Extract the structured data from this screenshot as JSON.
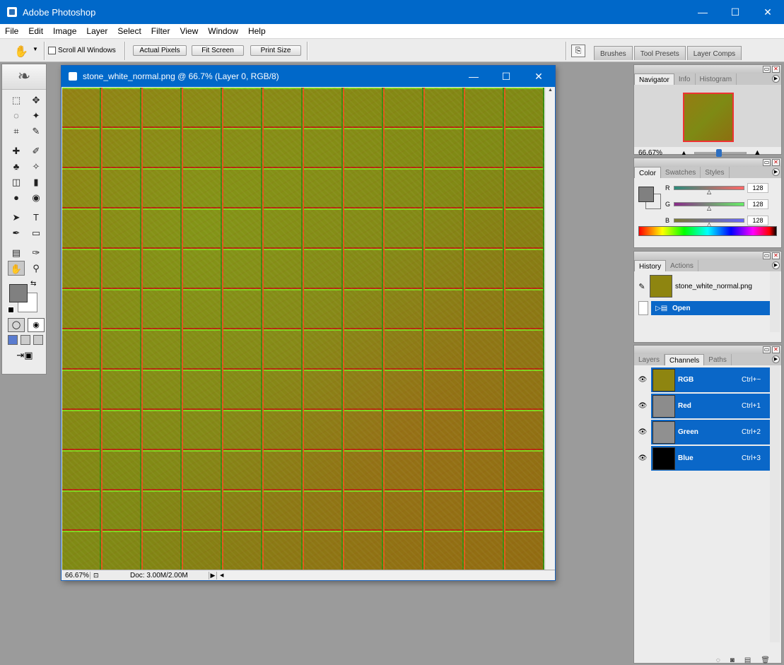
{
  "app": {
    "title": "Adobe Photoshop",
    "window_buttons": [
      "—",
      "☐",
      "✕"
    ]
  },
  "menu": [
    "File",
    "Edit",
    "Image",
    "Layer",
    "Select",
    "Filter",
    "View",
    "Window",
    "Help"
  ],
  "options": {
    "tool_icon": "hand-icon",
    "scroll_all_windows": "Scroll All Windows",
    "actual_pixels": "Actual Pixels",
    "fit_screen": "Fit Screen",
    "print_size": "Print Size",
    "well_tabs": [
      "Brushes",
      "Tool Presets",
      "Layer Comps"
    ]
  },
  "tools": [
    [
      "⬚",
      "✥"
    ],
    [
      "◌",
      "✦"
    ],
    [
      "⌗",
      "✎"
    ],
    [
      "✚",
      "✐"
    ],
    [
      "♣",
      "✧"
    ],
    [
      "◫",
      "▮"
    ],
    [
      "●",
      "◉"
    ],
    [
      "➤",
      "T"
    ],
    [
      "✒",
      "▭"
    ],
    [
      "▤",
      "✑"
    ],
    [
      "✋",
      "⚲"
    ]
  ],
  "document": {
    "title": "stone_white_normal.png @ 66.7% (Layer 0, RGB/8)",
    "zoom": "66.67%",
    "doc_size": "Doc: 3.00M/2.00M",
    "texture_color": "#8e7a0f"
  },
  "navigator": {
    "tabs": [
      "Navigator",
      "Info",
      "Histogram"
    ],
    "zoom": "66.67%",
    "slider_level": 0.45
  },
  "color": {
    "tabs": [
      "Color",
      "Swatches",
      "Styles"
    ],
    "channels": [
      {
        "label": "R",
        "value": "128",
        "bar_from": "#2a8a7a",
        "bar_to": "#ff6666"
      },
      {
        "label": "G",
        "value": "128",
        "bar_from": "#8a2a8a",
        "bar_to": "#66ee66"
      },
      {
        "label": "B",
        "value": "128",
        "bar_from": "#7a7a2a",
        "bar_to": "#6666ff"
      }
    ]
  },
  "history": {
    "tabs": [
      "History",
      "Actions"
    ],
    "snapshot": "stone_white_normal.png",
    "state": "Open"
  },
  "channels": {
    "tabs": [
      "Layers",
      "Channels",
      "Paths"
    ],
    "rows": [
      {
        "name": "RGB",
        "shortcut": "Ctrl+~",
        "thumb": "#8e8510"
      },
      {
        "name": "Red",
        "shortcut": "Ctrl+1",
        "thumb": "#8c8c8c"
      },
      {
        "name": "Green",
        "shortcut": "Ctrl+2",
        "thumb": "#909090"
      },
      {
        "name": "Blue",
        "shortcut": "Ctrl+3",
        "thumb": "#000000"
      }
    ]
  }
}
